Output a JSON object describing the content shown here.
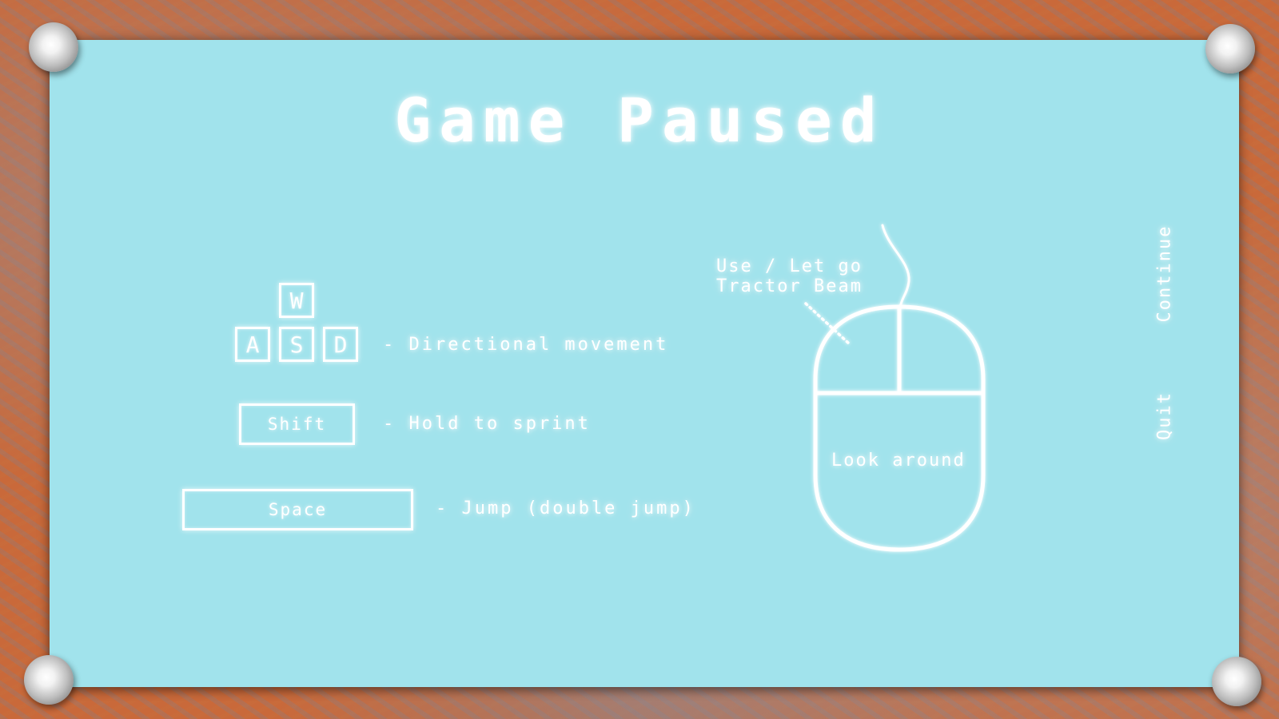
{
  "title": "Game Paused",
  "controls": {
    "wasd": {
      "keys": [
        "W",
        "A",
        "S",
        "D"
      ],
      "description": "- Directional movement"
    },
    "shift": {
      "key": "Shift",
      "description": "- Hold to sprint"
    },
    "space": {
      "key": "Space",
      "description": "- Jump (double jump)"
    }
  },
  "mouse": {
    "left_button_label_line1": "Use / Let go",
    "left_button_label_line2": "Tractor Beam",
    "body_label": "Look around"
  },
  "menu": {
    "continue_label": "Continue",
    "quit_label": "Quit"
  },
  "colors": {
    "board": "#a1e3ec",
    "frame": "#c9693a",
    "line": "#ffffff"
  }
}
